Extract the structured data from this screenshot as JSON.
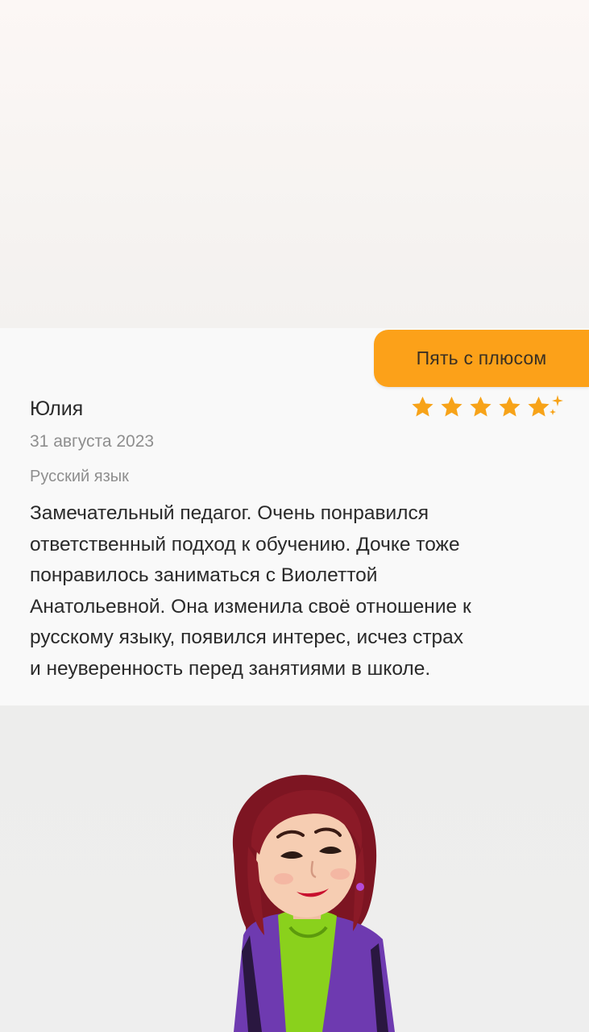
{
  "rating": {
    "badge_label": "Пять с плюсом",
    "stars": 5,
    "plus": true,
    "star_color": "#f7a319",
    "badge_color": "#fca119"
  },
  "review": {
    "name": "Юлия",
    "date": "31 августа 2023",
    "subject": "Русский язык",
    "text": "Замечательный педагог. Очень понравился\nответственный подход к обучению. Дочке тоже\nпонравилось заниматься с Виолеттой\nАнатольевной. Она изменила своё отношение к\nрусскому языку, появился интерес, исчез страх\nи неуверенность перед занятиями в школе."
  },
  "icons": {
    "rating_star": "star-icon",
    "plus_sparkle": "sparkle-icon",
    "avatar": "memoji-avatar"
  }
}
